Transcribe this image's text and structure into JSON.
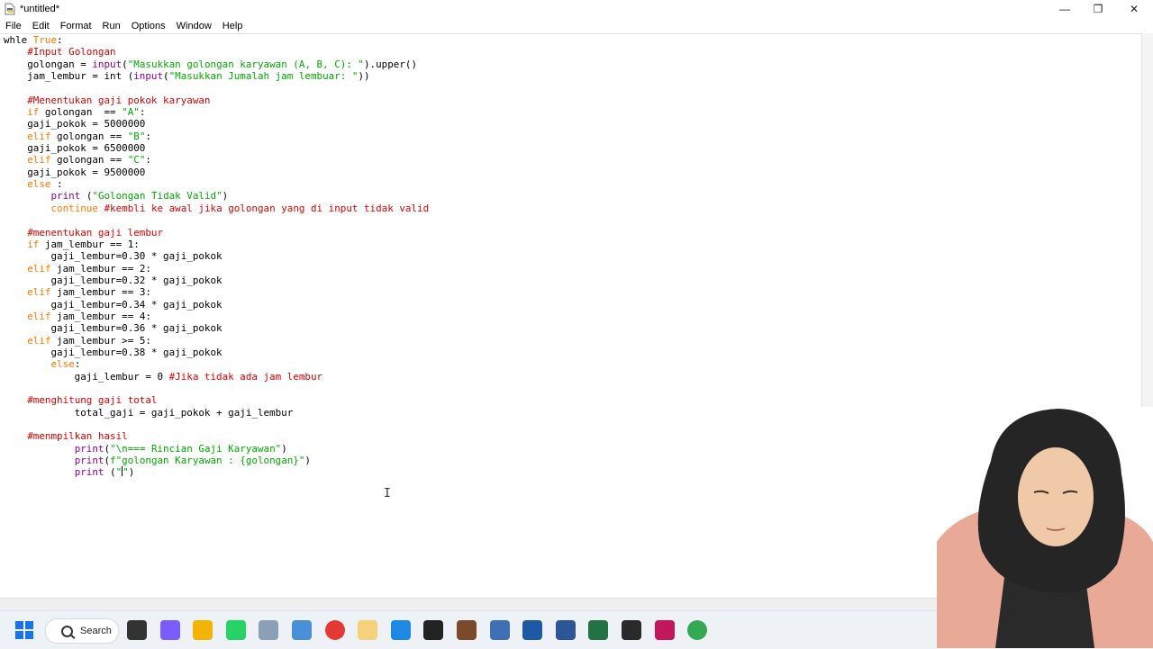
{
  "window": {
    "title": "*untitled*",
    "minimize_glyph": "—",
    "maximize_glyph": "❐",
    "close_glyph": "✕"
  },
  "menu": [
    "File",
    "Edit",
    "Format",
    "Run",
    "Options",
    "Window",
    "Help"
  ],
  "code_lines": [
    "whle True:",
    "    #Input Golongan",
    "    golongan = input(\"Masukkan golongan karyawan (A, B, C): \").upper()",
    "    jam_lembur = int (input(\"Masukkan Jumalah jam lembuar: \"))",
    "",
    "    #Menentukan gaji pokok karyawan",
    "    if golongan  == \"A\":",
    "    gaji_pokok = 5000000",
    "    elif golongan == \"B\":",
    "    gaji_pokok = 6500000",
    "    elif golongan == \"C\":",
    "    gaji_pokok = 9500000",
    "    else :",
    "        print (\"Golongan Tidak Valid\")",
    "        continue #kembli ke awal jika golongan yang di input tidak valid",
    "",
    "    #menentukan gaji lembur",
    "    if jam_lembur == 1:",
    "        gaji_lembur=0.30 * gaji_pokok",
    "    elif jam_lembur == 2:",
    "        gaji_lembur=0.32 * gaji_pokok",
    "    elif jam_lembur == 3:",
    "        gaji_lembur=0.34 * gaji_pokok",
    "    elif jam_lembur == 4:",
    "        gaji_lembur=0.36 * gaji_pokok",
    "    elif jam_lembur >= 5:",
    "        gaji_lembur=0.38 * gaji_pokok",
    "        else:",
    "            gaji_lembur = 0 #Jika tidak ada jam lembur",
    "",
    "    #menghitung gaji total",
    "            total_gaji = gaji_pokok + gaji_lembur",
    "",
    "    #menmpilkan hasil",
    "            print(\"\\n=== Rincian Gaji Karyawan\")",
    "            print(f\"golongan Karyawan : {golongan}\")",
    "            print (\"\")"
  ],
  "taskbar": {
    "search_label": "Search",
    "icons": [
      {
        "name": "task-view-icon",
        "color": "#333333"
      },
      {
        "name": "copilot-icon",
        "color": "#7b5cff"
      },
      {
        "name": "file-explorer-icon",
        "color": "#f2b400"
      },
      {
        "name": "whatsapp-icon",
        "color": "#25d366"
      },
      {
        "name": "snipping-tool-icon",
        "color": "#8aa0b8"
      },
      {
        "name": "paint-icon",
        "color": "#4a90d9"
      },
      {
        "name": "chrome-icon",
        "color": "#e53935"
      },
      {
        "name": "cat-app-icon",
        "color": "#f5d27a"
      },
      {
        "name": "vscode-icon",
        "color": "#1e88e5"
      },
      {
        "name": "soccer-app-icon",
        "color": "#222222"
      },
      {
        "name": "character-app-icon",
        "color": "#7a4a2a"
      },
      {
        "name": "presenter-app-icon",
        "color": "#3f6fb5"
      },
      {
        "name": "virtualbox-icon",
        "color": "#1c5aa6"
      },
      {
        "name": "word-icon",
        "color": "#2b579a"
      },
      {
        "name": "excel-icon",
        "color": "#217346"
      },
      {
        "name": "obs-icon",
        "color": "#2a2a2a"
      },
      {
        "name": "idle-python-icon",
        "color": "#c2185b"
      },
      {
        "name": "chrome-profile-icon",
        "color": "#34a853"
      }
    ]
  },
  "colors": {
    "keyword": "#ff7700",
    "builtin": "#900090",
    "string": "#00aa00",
    "comment": "#dd0000"
  }
}
